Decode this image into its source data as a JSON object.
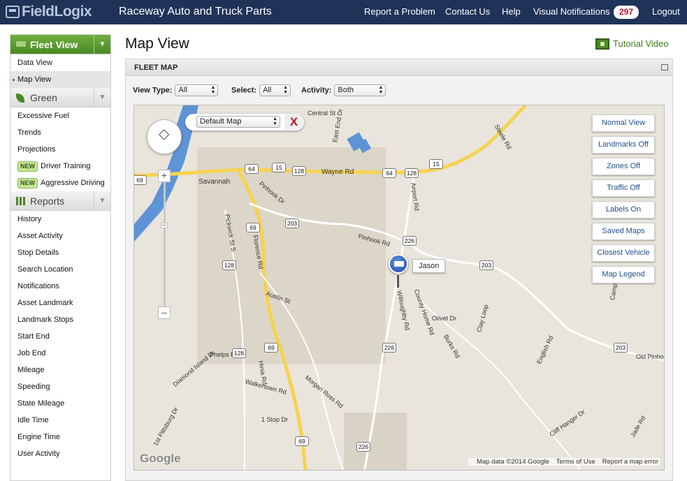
{
  "brand": {
    "logo": "FieldLogix",
    "company": "Raceway Auto and Truck Parts"
  },
  "topnav": {
    "report": "Report a Problem",
    "contact": "Contact Us",
    "help": "Help",
    "visual": "Visual Notifications",
    "notif_count": "297",
    "logout": "Logout"
  },
  "sidebar": {
    "fleet": {
      "title": "Fleet View",
      "items": [
        "Data View",
        "Map View"
      ]
    },
    "green": {
      "title": "Green",
      "items": [
        "Excessive Fuel",
        "Trends",
        "Projections"
      ],
      "new_badge": "NEW",
      "driver_training": "Driver Training",
      "aggressive_driving": "Aggressive Driving"
    },
    "reports": {
      "title": "Reports",
      "items": [
        "History",
        "Asset Activity",
        "Stop Details",
        "Search Location",
        "Notifications",
        "Asset Landmark",
        "Landmark Stops",
        "Start End",
        "Job End",
        "Mileage",
        "Speeding",
        "State Mileage",
        "Idle Time",
        "Engine Time",
        "User Activity"
      ]
    }
  },
  "page": {
    "title": "Map View",
    "tutorial": "Tutorial Video"
  },
  "panel": {
    "title": "FLEET MAP"
  },
  "filters": {
    "view_type_label": "View Type:",
    "view_type_value": "All",
    "select_label": "Select:",
    "select_value": "All",
    "activity_label": "Activity:",
    "activity_value": "Both"
  },
  "map": {
    "base_layer": "Default Map",
    "close": "X",
    "buttons": [
      "Normal View",
      "Landmarks Off",
      "Zones Off",
      "Traffic Off",
      "Labels On",
      "Saved Maps",
      "Closest Vehicle",
      "Map Legend"
    ],
    "vehicle_label": "Jason",
    "roads": [
      "Central St",
      "East End Dr",
      "Wayne Rd",
      "Savannah",
      "Pinhook Dr",
      "Pickwick St S",
      "Florence Rd",
      "Airport Rd",
      "Pinhook Rd",
      "Austin St",
      "Phelps Rd",
      "Diamond Island Dr",
      "Hinia Rd",
      "Walkertown Rd",
      "Morgan Ross Rd",
      "1 Stop Dr",
      "1st Pittsburg Dr",
      "Willoughby Rd",
      "County Home Rd",
      "Olivet Dr",
      "Clay Loop",
      "Burks Rd",
      "English Rd",
      "Old Pinhook",
      "Cliff Hanger Dr",
      "Jade Rd",
      "Steele Rd",
      "Camp"
    ],
    "shields": [
      "64",
      "15",
      "128",
      "64",
      "128",
      "15",
      "69",
      "203",
      "226",
      "203",
      "128",
      "69",
      "69",
      "128",
      "226",
      "203",
      "226",
      "69"
    ],
    "google": "Google",
    "attribution": {
      "data": "Map data ©2014 Google",
      "terms": "Terms of Use",
      "report": "Report a map error"
    }
  },
  "colors": {
    "navy": "#1f3358",
    "green": "#4a8a24",
    "alert": "#c8102e",
    "highway": "#f6d250",
    "water": "#5e94d6"
  }
}
